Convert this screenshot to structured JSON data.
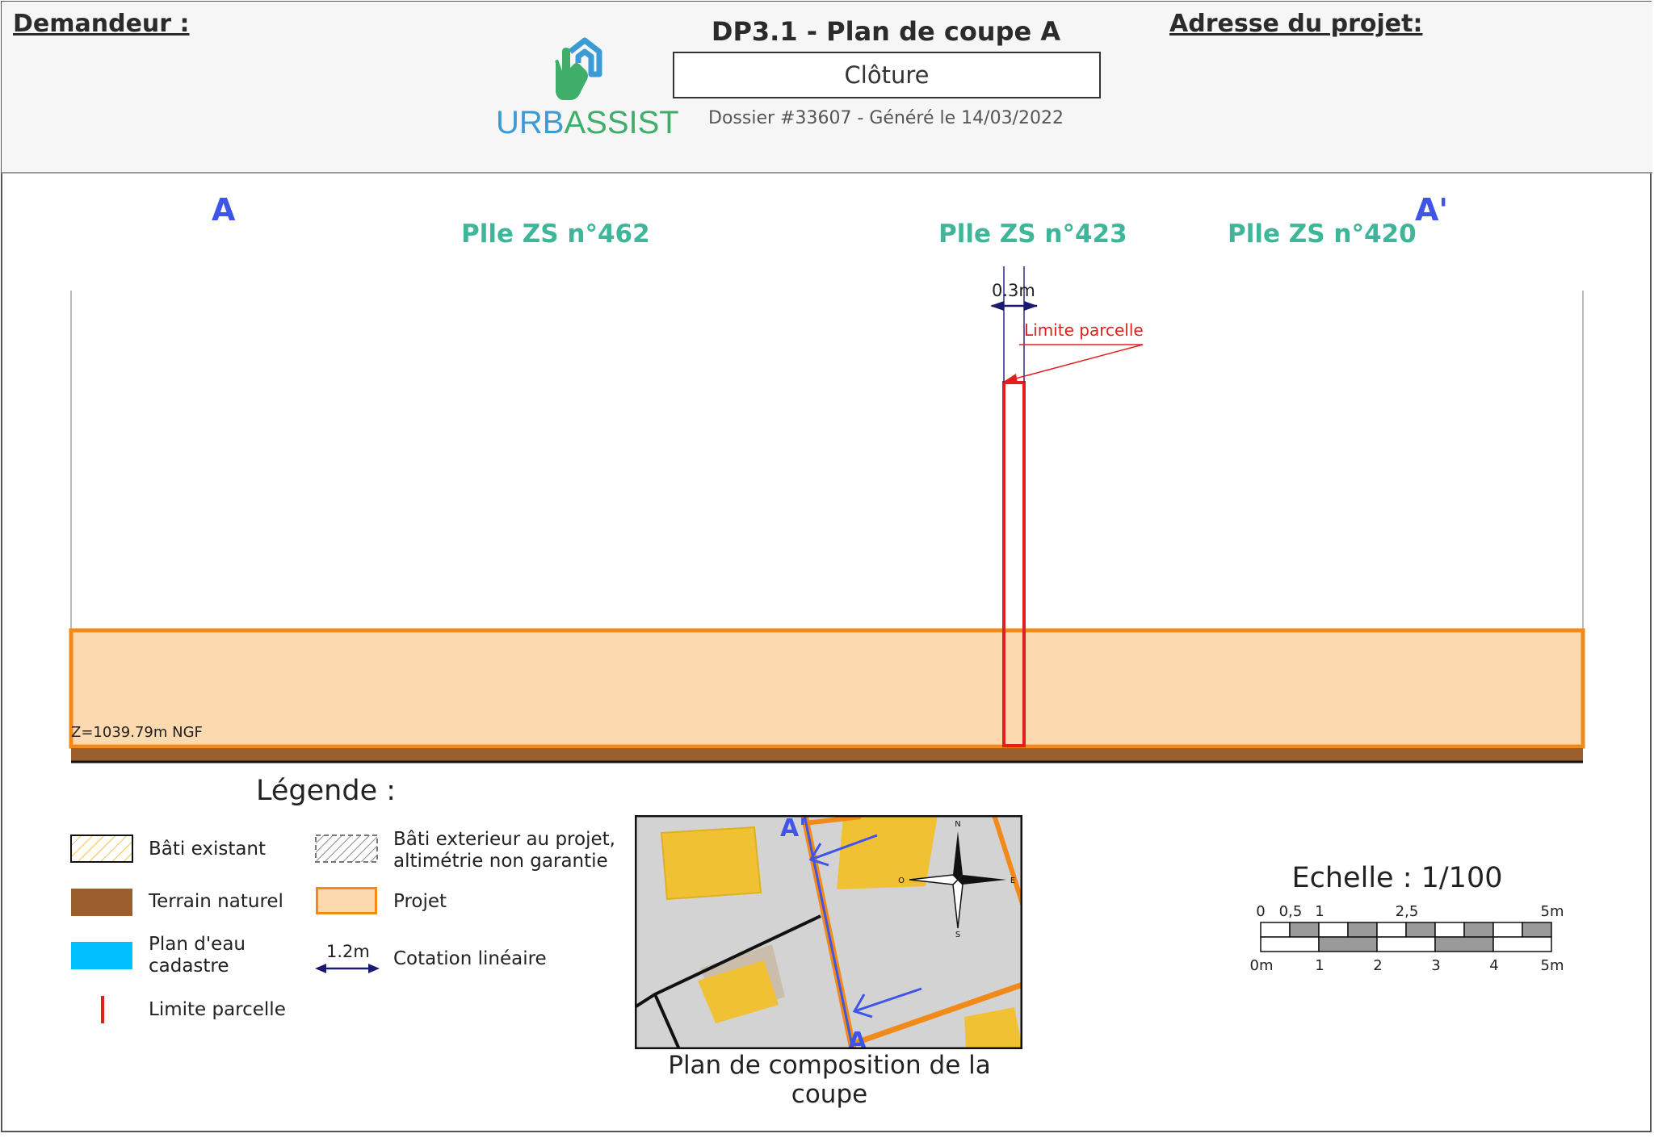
{
  "header": {
    "demandeur_label": "Demandeur :",
    "title": "DP3.1 - Plan de coupe A",
    "subject": "Clôture",
    "dossier": "Dossier #33607 - Généré le 14/03/2022",
    "adresse_label": "Adresse du projet:",
    "logo": {
      "part1": "URB",
      "part2": "ASSIST",
      "icon": "hand-house-icon"
    }
  },
  "section": {
    "start_label": "A",
    "end_label": "A'",
    "parcels": [
      "Plle ZS n°462",
      "Plle ZS n°423",
      "Plle ZS n°420"
    ],
    "dimension_label": "0.3m",
    "limit_label": "Limite parcelle",
    "elevation_label": "Z=1039.79m NGF"
  },
  "legend": {
    "title": "Légende :",
    "items": [
      {
        "label": "Bâti existant",
        "swatch": "hatch-yellow"
      },
      {
        "label": "Terrain naturel",
        "swatch": "brown",
        "color": "#9b5f2e"
      },
      {
        "label": "Plan d'eau cadastre",
        "line1": "Plan d'eau",
        "line2": "cadastre",
        "swatch": "blue",
        "color": "#00bfff"
      },
      {
        "label": "Limite parcelle",
        "swatch": "red-line",
        "color": "#e02020"
      },
      {
        "label": "Bâti exterieur au projet, altimétrie non garantie",
        "line1": "Bâti exterieur au projet,",
        "line2": "altimétrie non garantie",
        "swatch": "hatch-grey"
      },
      {
        "label": "Projet",
        "swatch": "orange",
        "color": "#fdd9b0"
      },
      {
        "label": "Cotation linéaire",
        "swatch": "dimension-arrow",
        "sample_value": "1.2m"
      }
    ]
  },
  "map": {
    "caption": "Plan de composition de la coupe",
    "marker_start": "A",
    "marker_end": "A'",
    "compass": {
      "n": "N",
      "s": "S",
      "e": "E",
      "o": "O"
    }
  },
  "scale": {
    "title": "Echelle : 1/100",
    "top_ticks": [
      "0",
      "0,5",
      "1",
      "2,5",
      "5m"
    ],
    "bottom_ticks": [
      "0m",
      "1",
      "2",
      "3",
      "4",
      "5m"
    ]
  },
  "colors": {
    "project_fill": "#fdd9b0",
    "project_stroke": "#f28a1a",
    "terrain": "#9b5f2e",
    "limit": "#e02020",
    "section_label": "#3f55e8",
    "parcel_label": "#3fb59a"
  }
}
